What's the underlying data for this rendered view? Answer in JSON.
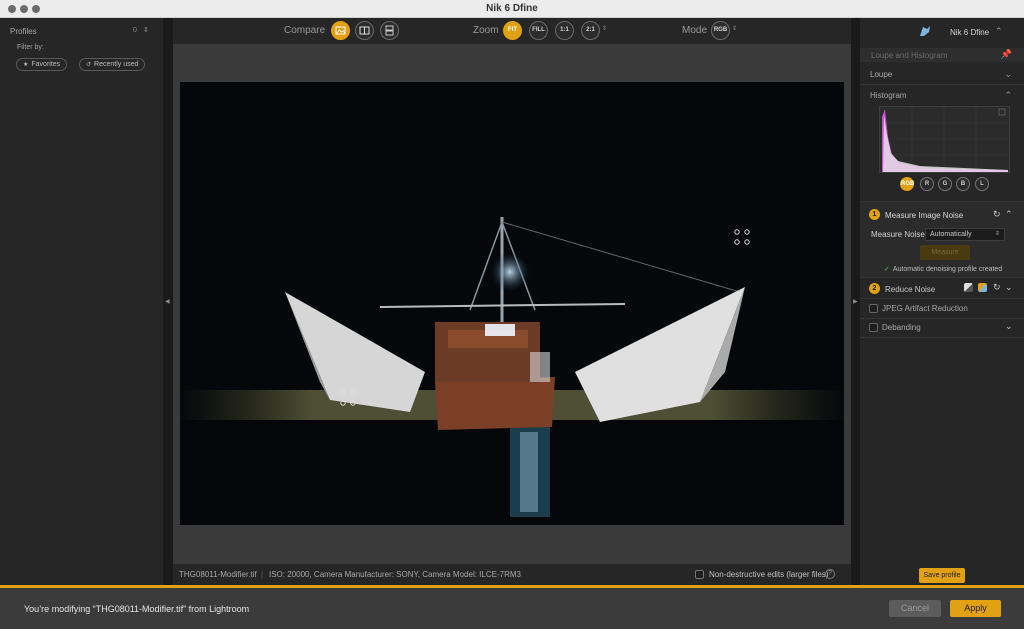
{
  "window": {
    "title": "Nik 6 Dfine"
  },
  "left_panel": {
    "profiles_label": "Profiles",
    "profiles_count": "0",
    "filter_label": "Filter by:",
    "filters": [
      {
        "label": "Favorites",
        "icon": "star-icon"
      },
      {
        "label": "Recently used",
        "icon": "history-icon"
      }
    ]
  },
  "toolbar": {
    "compare_label": "Compare",
    "zoom_label": "Zoom",
    "zoom_options": [
      "FIT",
      "FILL",
      "1:1",
      "2:1"
    ],
    "zoom_active": "FIT",
    "mode_label": "Mode",
    "mode_value": "RGB"
  },
  "status_bar": {
    "filename": "THG08011-Modifier.tif",
    "separator": "|",
    "metadata": "ISO: 20000, Camera Manufacturer: SONY, Camera Model: ILCE-7RM3",
    "non_destructive_label": "Non-destructive edits (larger files)",
    "help": "?"
  },
  "right_panel": {
    "app_name": "Nik 6 Dfine",
    "loupe_histogram_label": "Loupe and Histogram",
    "loupe_label": "Loupe",
    "histogram_label": "Histogram",
    "channels": [
      "RGB",
      "R",
      "G",
      "B",
      "L"
    ],
    "active_channel": "RGB",
    "step1": {
      "number": "1",
      "title": "Measure Image Noise",
      "measure_noise_label": "Measure Noise",
      "measure_noise_value": "Automatically",
      "measure_button": "Measure",
      "status": "Automatic denoising profile created"
    },
    "step2": {
      "number": "2",
      "title": "Reduce Noise"
    },
    "jpeg_label": "JPEG Artifact Reduction",
    "debanding_label": "Debanding",
    "save_profile": "Save profile"
  },
  "bottom_bar": {
    "message": "You’re modifying “THG08011-Modifier.tif” from Lightroom",
    "cancel": "Cancel",
    "apply": "Apply"
  },
  "colors": {
    "accent": "#e2a112",
    "panel": "#262626",
    "canvas": "#3a3a3a"
  }
}
